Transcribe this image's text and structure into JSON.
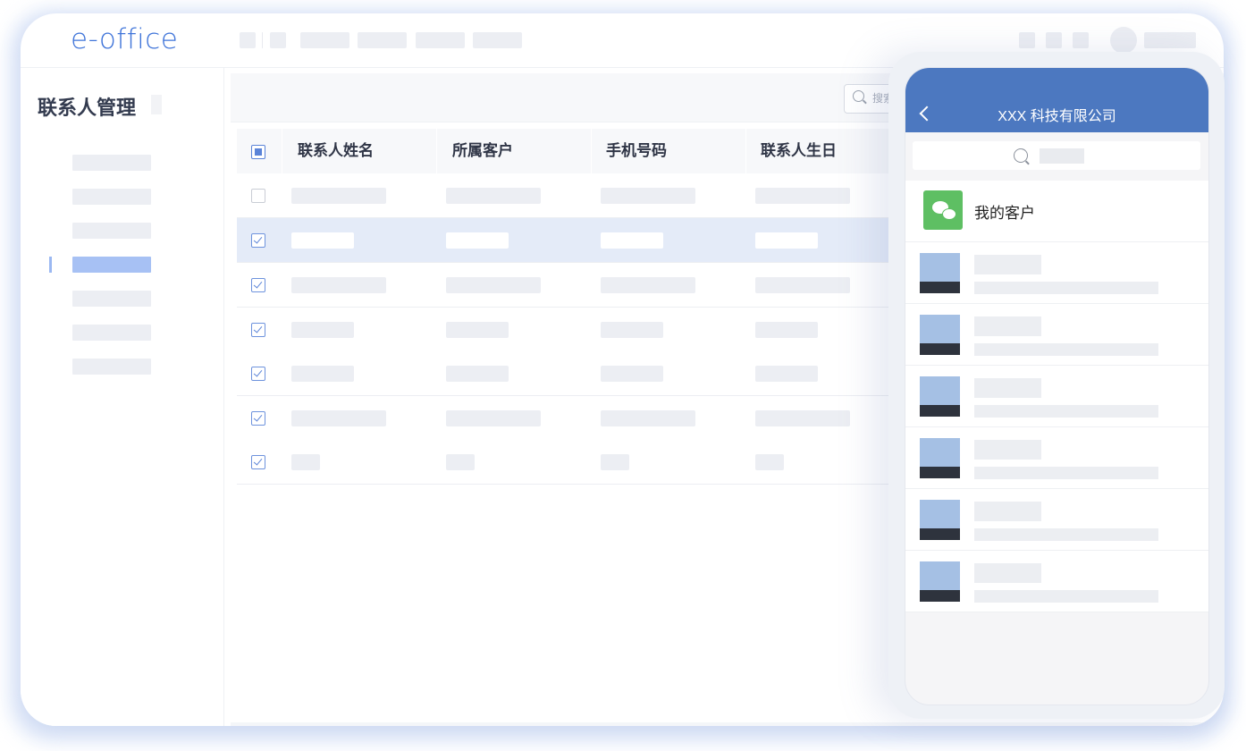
{
  "app": {
    "logo": "e-office"
  },
  "sidebar": {
    "title": "联系人管理",
    "nav_count": 7,
    "active_index": 3
  },
  "toolbar": {
    "search_placeholder": "搜索"
  },
  "table": {
    "columns": [
      "联系人姓名",
      "所属客户",
      "手机号码",
      "联系人生日"
    ],
    "rows": [
      {
        "checked": false,
        "selected": false
      },
      {
        "checked": true,
        "selected": true
      },
      {
        "checked": true,
        "selected": false
      },
      {
        "checked": true,
        "selected": false
      },
      {
        "checked": true,
        "selected": false
      },
      {
        "checked": true,
        "selected": false
      },
      {
        "checked": true,
        "selected": false
      }
    ]
  },
  "phone": {
    "title": "XXX 科技有限公司",
    "my_customers": "我的客户",
    "contact_count": 6
  },
  "colors": {
    "accent": "#3f74d9",
    "phone_header": "#4c78c0",
    "selected_row": "#e4ebf8",
    "wechat": "#5ebf63"
  }
}
